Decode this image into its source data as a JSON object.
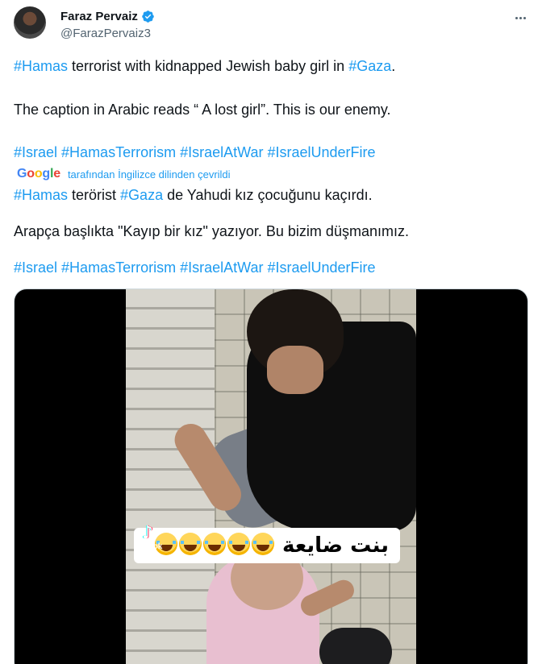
{
  "author": {
    "name": "Faraz Pervaiz",
    "handle": "@FarazPervaiz3",
    "verified": true,
    "verified_color": "#1d9bf0"
  },
  "tweet": {
    "line1": {
      "tag1": "#Hamas",
      "text": " terrorist with kidnapped Jewish baby girl in ",
      "tag2": "#Gaza",
      "end": "."
    },
    "line2": "The caption in Arabic reads “ A lost girl”.  This is our enemy.",
    "hashtags": [
      "#Israel",
      "#HamasTerrorism",
      "#IsraelAtWar",
      "#IsraelUnderFire"
    ]
  },
  "translation": {
    "provider": "Google",
    "label": "tarafından İngilizce dilinden çevrildi",
    "line1": {
      "tag1": "#Hamas",
      "text1": " terörist ",
      "tag2": "#Gaza",
      "text2": " de Yahudi kız çocuğunu kaçırdı."
    },
    "line2": "Arapça başlıkta \"Kayıp bir kız\" yazıyor. Bu bizim düşmanımız.",
    "hashtags": [
      "#Israel",
      "#HamasTerrorism",
      "#IsraelAtWar",
      "#IsraelUnderFire"
    ]
  },
  "media": {
    "caption_arabic": "بنت ضايعة",
    "emoji_count": 5,
    "watermark": "TikTok"
  },
  "colors": {
    "link": "#1d9bf0",
    "text": "#0f1419",
    "secondary": "#536471"
  }
}
